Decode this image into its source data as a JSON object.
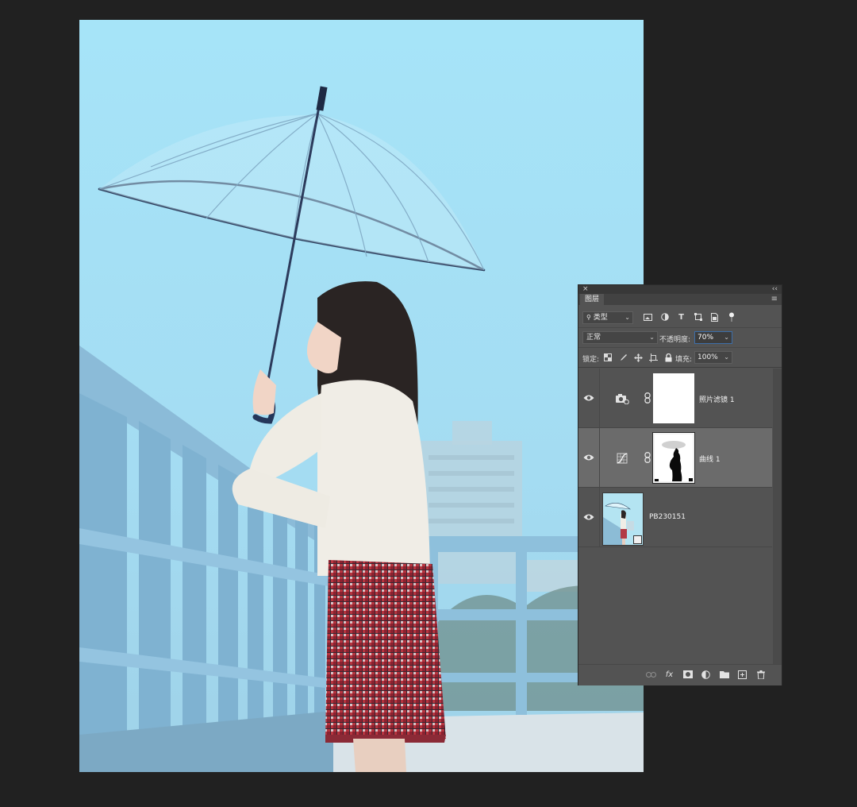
{
  "canvas": {
    "subject": "photo"
  },
  "panel": {
    "close_glyph": "×",
    "collapse_glyph": "‹‹",
    "tab_label": "图层",
    "menu_glyph": "≡",
    "filter": {
      "kind_label": "类型",
      "icons": [
        "image-filter-icon",
        "adjustment-filter-icon",
        "type-filter-icon",
        "shape-filter-icon",
        "smart-object-filter-icon",
        "filter-toggle-icon"
      ]
    },
    "blend_mode": "正常",
    "opacity_label": "不透明度:",
    "opacity_value": "70%",
    "lock_label": "锁定:",
    "fill_label": "填充:",
    "fill_value": "100%",
    "layers": [
      {
        "name": "照片滤镜 1",
        "type": "photo-filter-adjustment",
        "visible": true,
        "selected": false
      },
      {
        "name": "曲线 1",
        "type": "curves-adjustment",
        "visible": true,
        "selected": true
      },
      {
        "name": "PB230151",
        "type": "smart-object",
        "visible": true,
        "selected": false
      }
    ],
    "footer_icons": [
      "link-layers-icon",
      "fx-icon",
      "add-mask-icon",
      "new-adjustment-icon",
      "new-group-icon",
      "new-layer-icon",
      "delete-layer-icon"
    ],
    "fx_text": "fx"
  }
}
